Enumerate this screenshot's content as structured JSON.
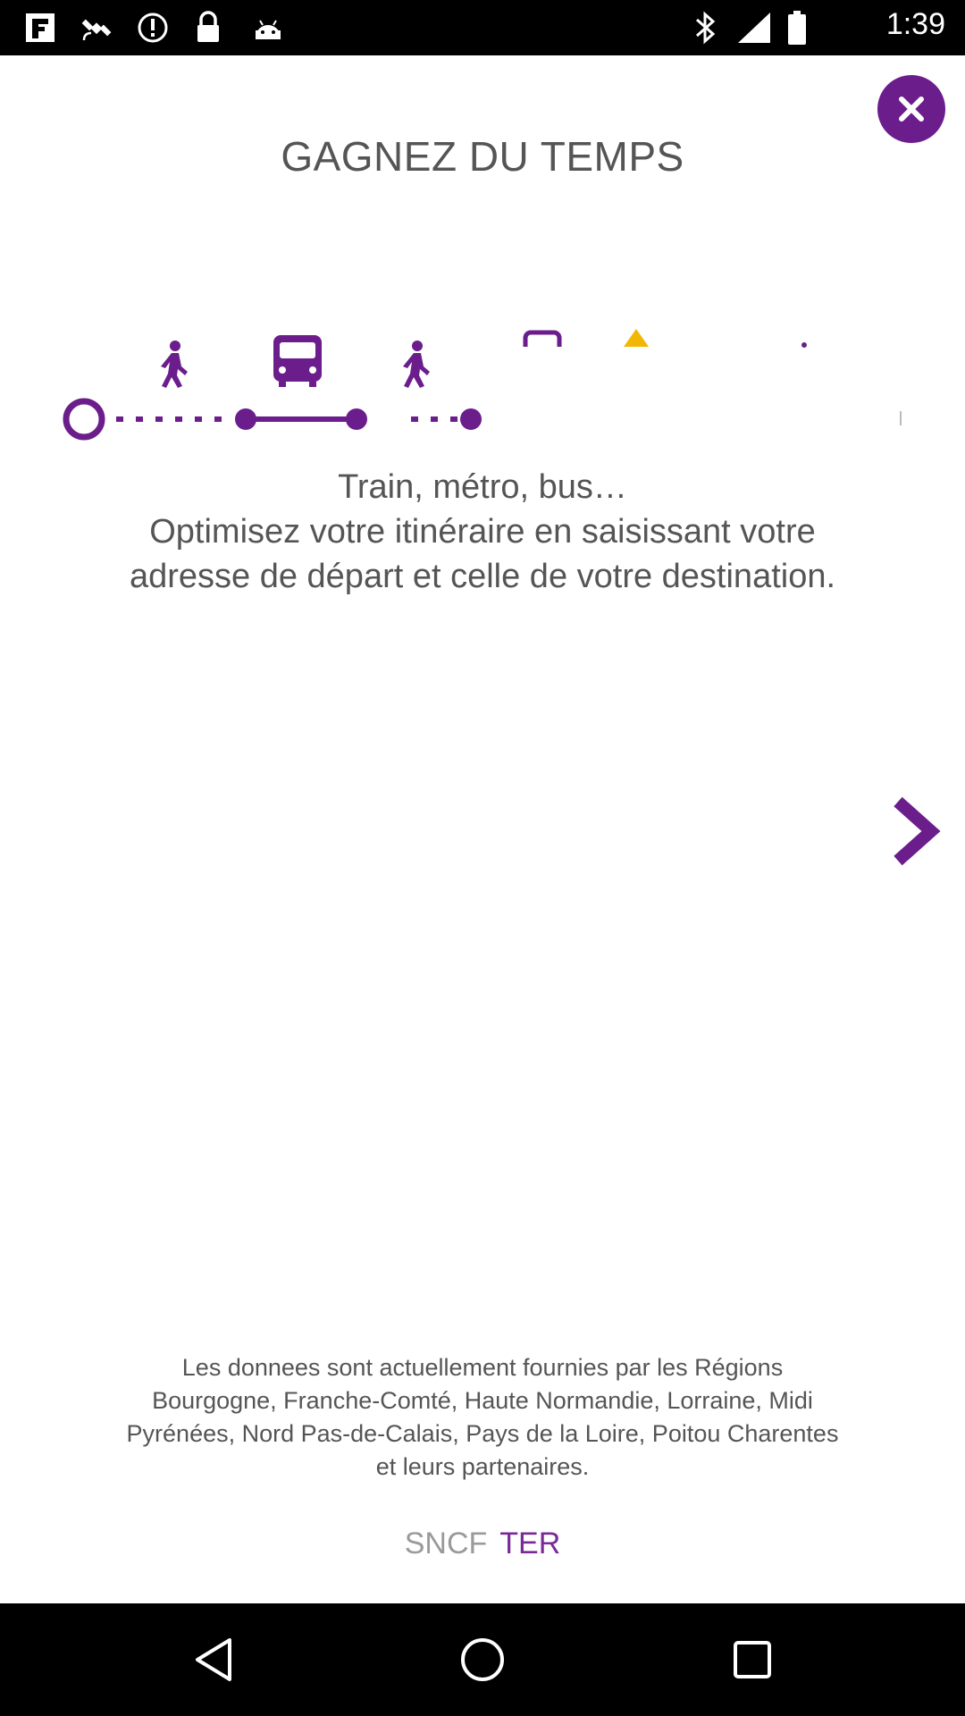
{
  "status_bar": {
    "time": "1:39",
    "icons": [
      "fake-app-icon",
      "satellite-icon",
      "alert-icon",
      "lock-icon",
      "android-icon",
      "bluetooth-icon",
      "signal-icon",
      "battery-icon"
    ]
  },
  "onboarding": {
    "title": "GAGNEZ DU TEMPS",
    "description_lines": [
      "Train, métro, bus…",
      "Optimisez votre itinéraire en saisissant votre",
      "adresse de départ et celle de votre destination."
    ],
    "footer_lines": [
      "Les donnees sont actuellement fournies par les Régions",
      "Bourgogne, Franche-Comté, Haute Normandie, Lorraine, Midi",
      "Pyrénées, Nord Pas-de-Calais, Pays de la Loire, Poitou Charentes",
      "et leurs partenaires."
    ],
    "brand_sncf": "SNCF",
    "brand_ter": "TER"
  },
  "colors": {
    "accent": "#6b1d8c",
    "accent_light": "#7a2a98",
    "text": "#555555",
    "warning": "#f2b705"
  },
  "nav_bar": {
    "buttons": [
      "back-icon",
      "home-icon",
      "recents-icon"
    ]
  }
}
